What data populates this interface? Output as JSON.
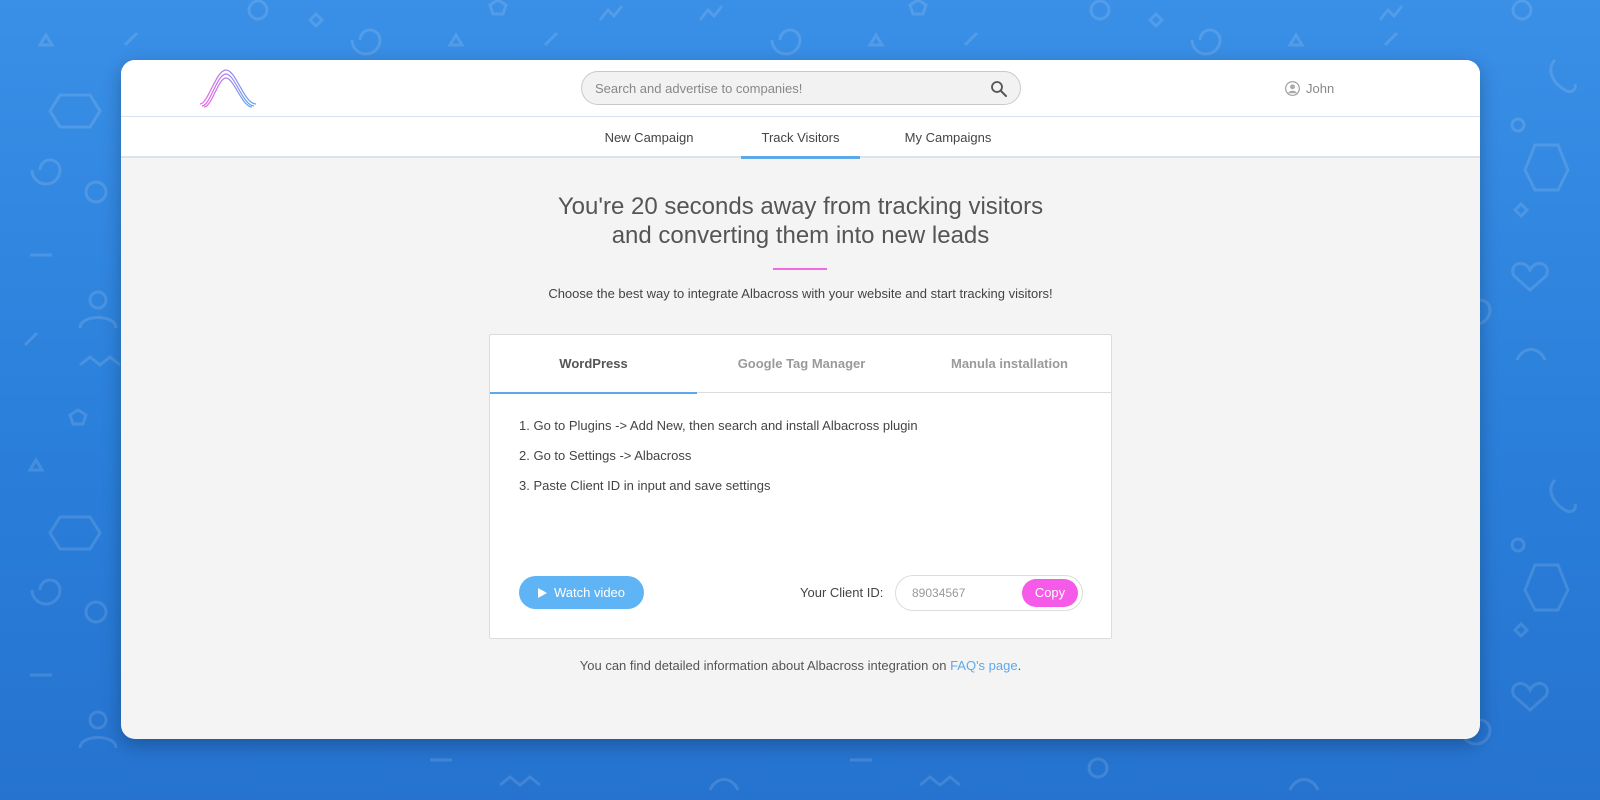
{
  "header": {
    "search_placeholder": "Search and advertise to companies!",
    "user_name": "John"
  },
  "nav": {
    "items": [
      {
        "label": "New Campaign"
      },
      {
        "label": "Track Visitors"
      },
      {
        "label": "My Campaigns"
      }
    ],
    "active_index": 1
  },
  "main": {
    "headline_line1": "You're 20 seconds away from tracking visitors",
    "headline_line2": "and converting them into new leads",
    "subline": "Choose the best way to integrate Albacross with your website and start tracking visitors!"
  },
  "panel": {
    "tabs": [
      {
        "label": "WordPress"
      },
      {
        "label": "Google Tag Manager"
      },
      {
        "label": "Manula installation"
      }
    ],
    "active_tab": 0,
    "steps": [
      "1. Go to Plugins -> Add New, then search and install Albacross plugin",
      "2. Go to Settings -> Albacross",
      "3. Paste Client ID in input and save settings"
    ],
    "watch_video_label": "Watch video",
    "client_id_label": "Your Client ID:",
    "client_id_value": "89034567",
    "copy_label": "Copy"
  },
  "footer": {
    "note_prefix": "You can find detailed information about Albacross integration on ",
    "link_text": "FAQ's page",
    "note_suffix": "."
  },
  "colors": {
    "accent_blue": "#5fa8e8",
    "accent_pink": "#f55be8",
    "background_blue": "#2a7fda"
  }
}
